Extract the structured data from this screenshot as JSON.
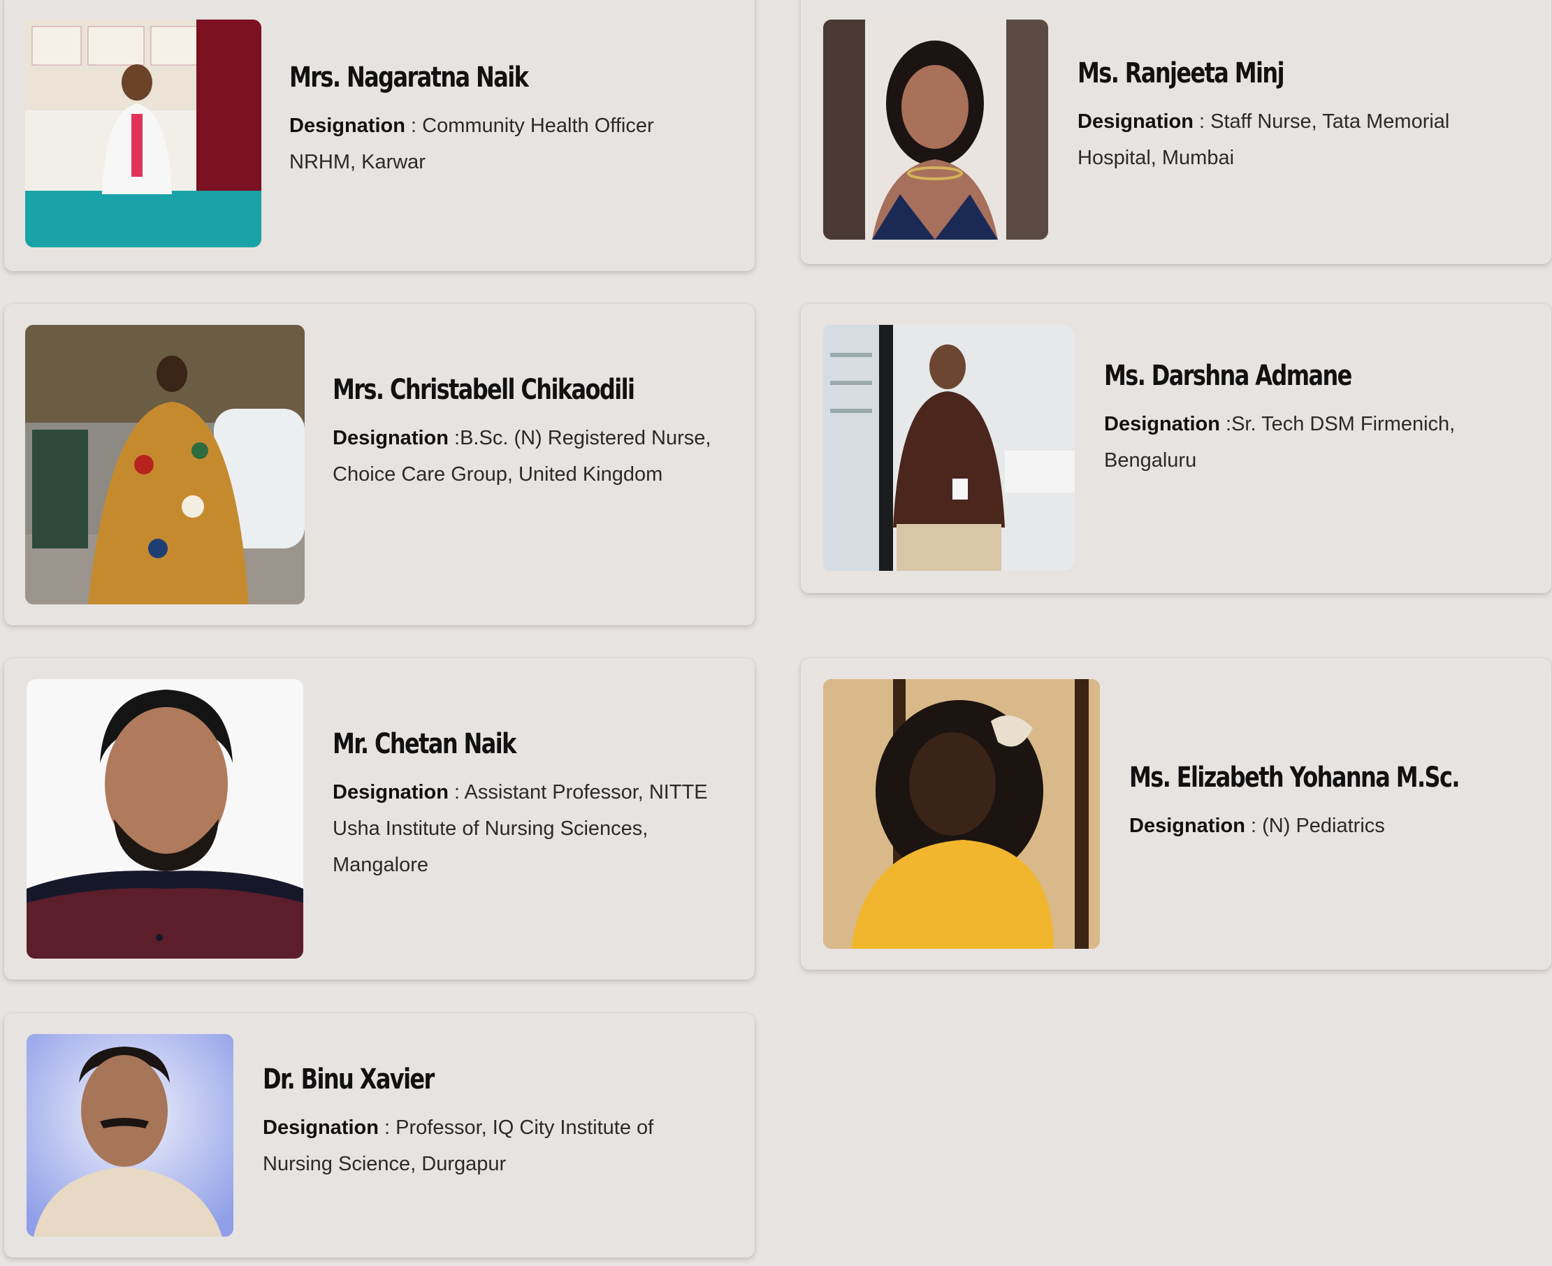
{
  "designation_label": "Designation",
  "people": [
    {
      "name": "Mrs. Nagaratna Naik",
      "designation": " : Community Health Officer NRHM, Karwar",
      "photo_icon": "person-photo"
    },
    {
      "name": "Ms. Ranjeeta Minj",
      "designation": " : Staff Nurse, Tata Memorial Hospital, Mumbai",
      "photo_icon": "person-photo"
    },
    {
      "name": "Mrs. Christabell Chikaodili",
      "designation": " :B.Sc. (N) Registered Nurse, Choice Care Group, United Kingdom",
      "photo_icon": "person-photo"
    },
    {
      "name": "Ms. Darshna Admane",
      "designation": " :Sr. Tech DSM Firmenich, Bengaluru",
      "photo_icon": "person-photo"
    },
    {
      "name": "Mr. Chetan Naik",
      "designation": " : Assistant Professor, NITTE Usha Institute of Nursing Sciences, Mangalore",
      "photo_icon": "person-photo"
    },
    {
      "name": "Ms. Elizabeth Yohanna M.Sc.",
      "designation": " : (N) Pediatrics",
      "photo_icon": "person-photo"
    },
    {
      "name": "Dr. Binu Xavier",
      "designation": " : Professor, IQ City Institute of Nursing Science, Durgapur",
      "photo_icon": "person-photo"
    }
  ]
}
